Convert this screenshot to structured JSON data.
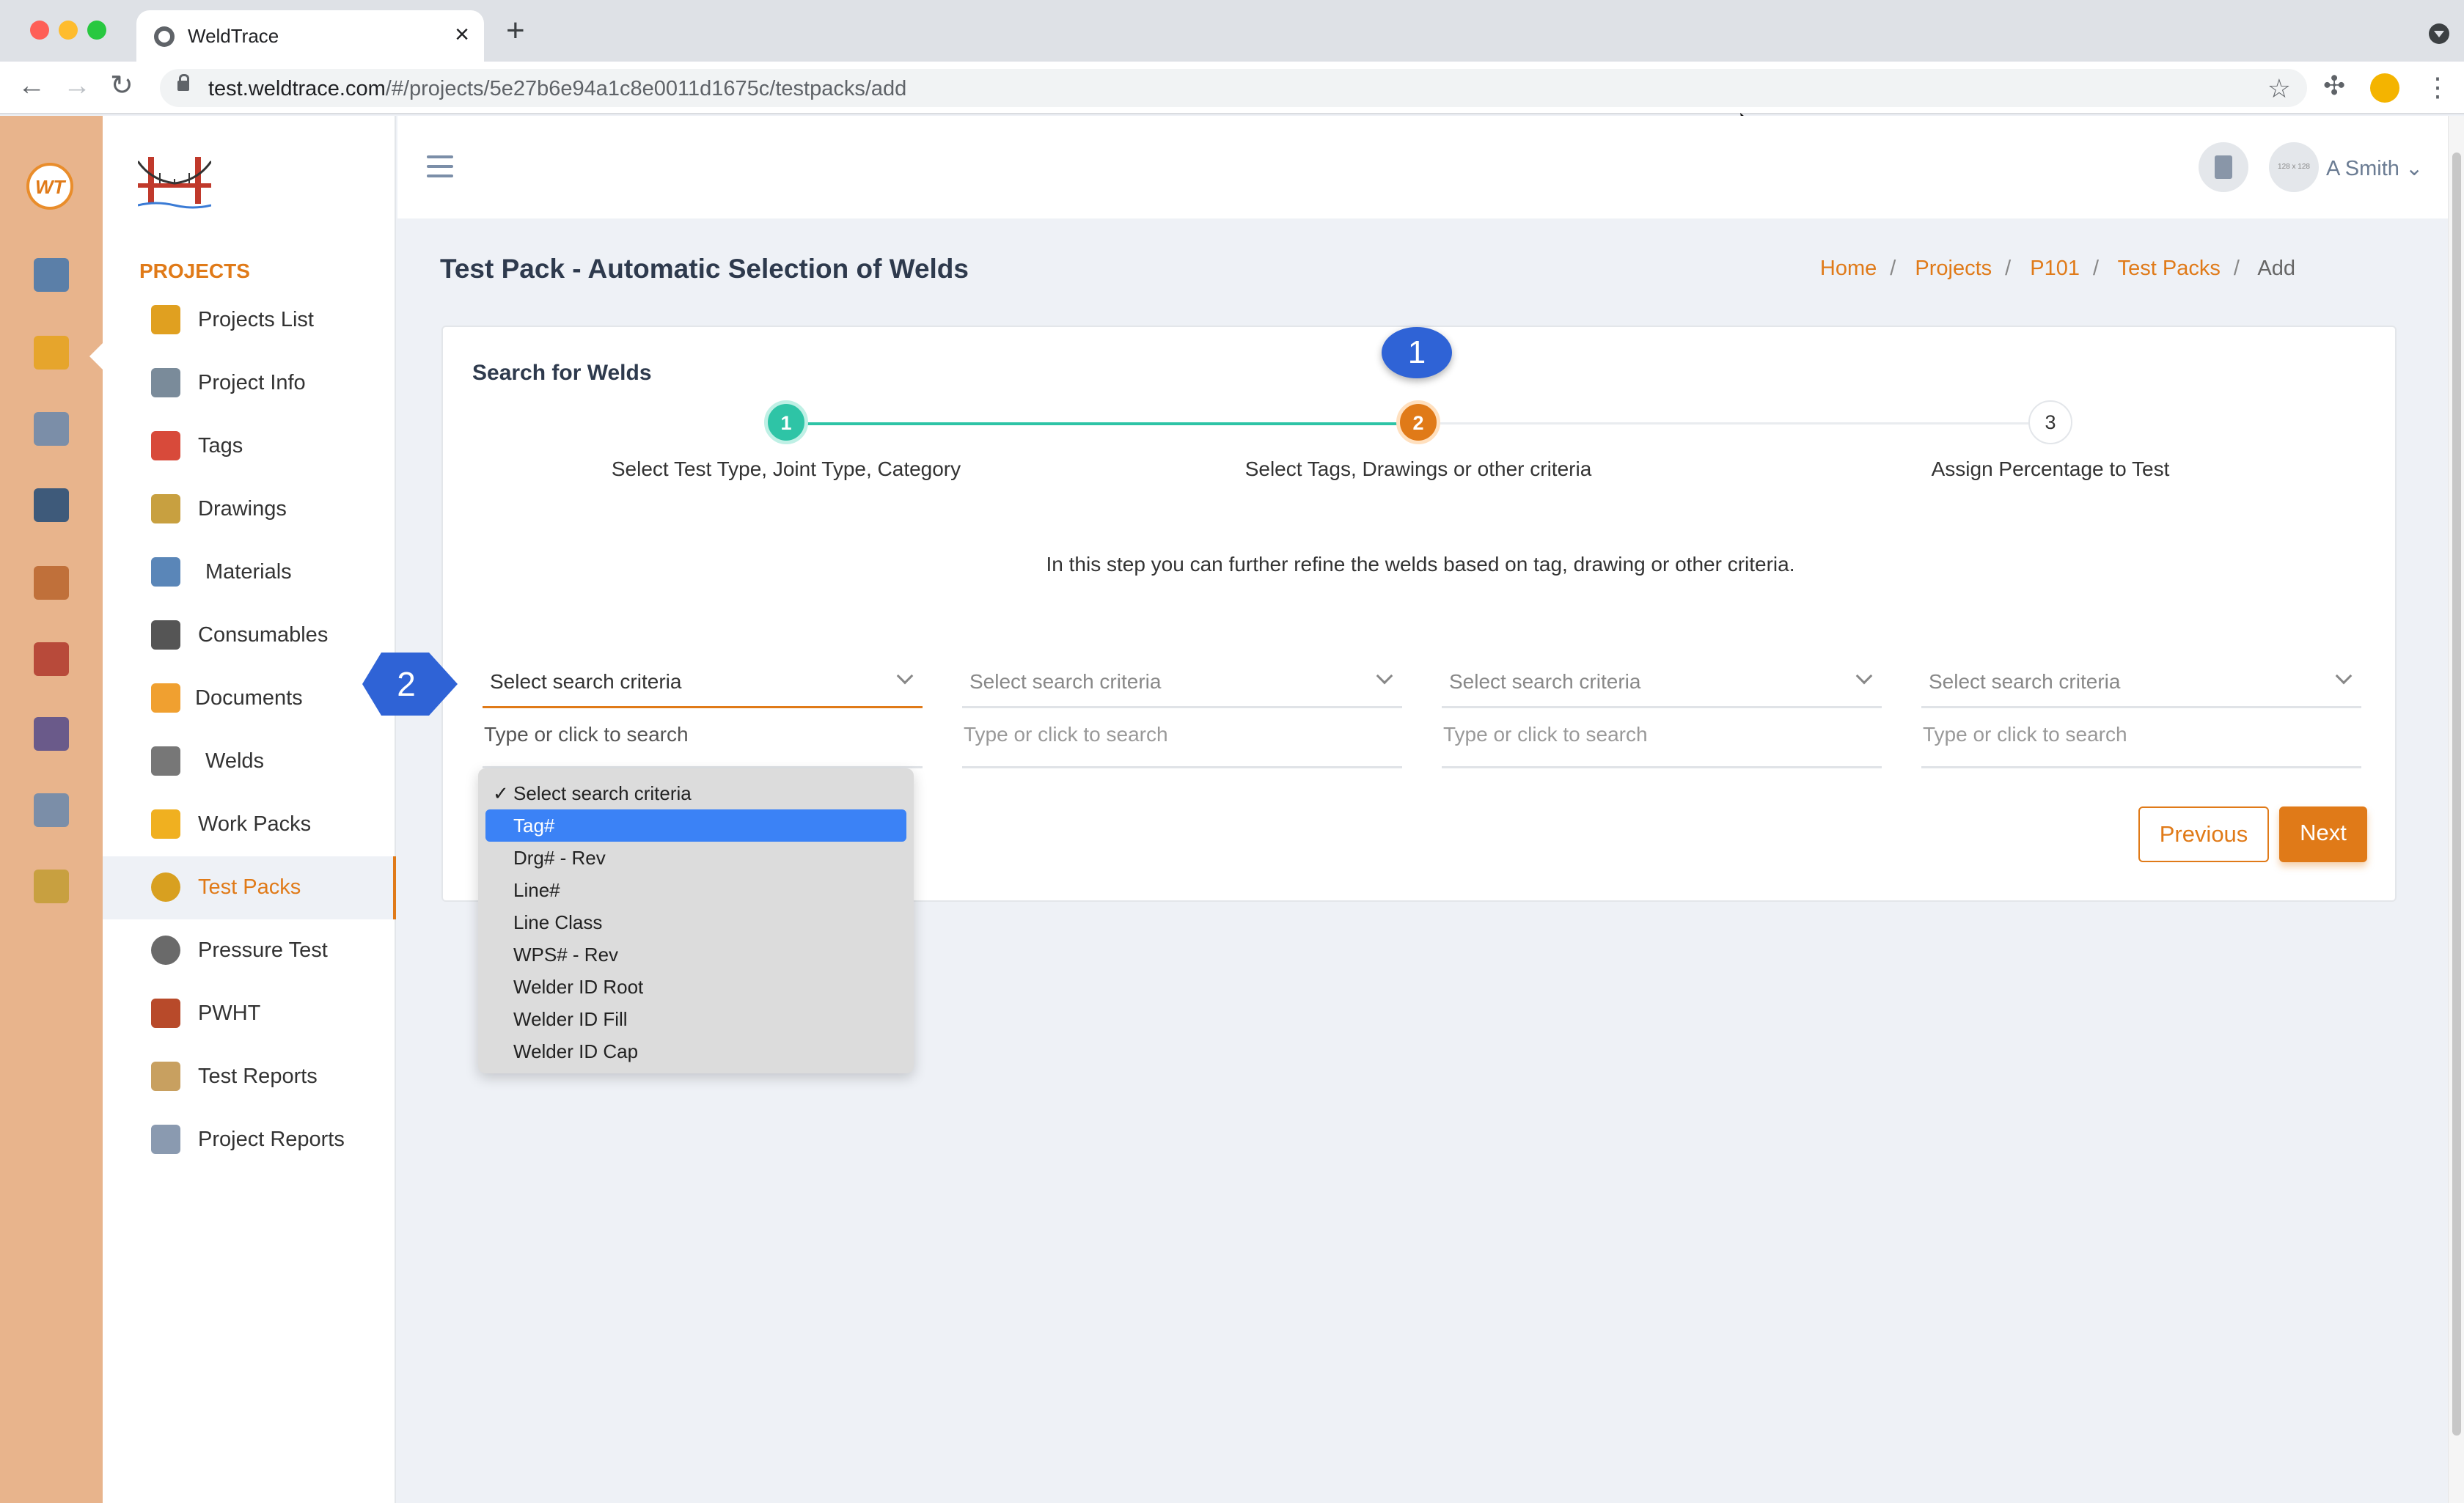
{
  "browser": {
    "tab_title": "WeldTrace",
    "url_host": "test.weldtrace.com",
    "url_path": "/#/projects/5e27b6e94a1c8e0011d1675c/testpacks/add"
  },
  "rail": {
    "logo_text": "WT",
    "icons": [
      "monitor-icon",
      "project-folder-icon",
      "clipboard-icon",
      "welder-mask-icon",
      "org-chart-icon",
      "report-icon",
      "team-icon",
      "inspection-icon",
      "certificate-icon"
    ]
  },
  "sidebar": {
    "section_title": "PROJECTS",
    "items": [
      {
        "label": "Projects List",
        "icon": "projects-list-icon",
        "color": "#e0a020"
      },
      {
        "label": "Project Info",
        "icon": "project-info-icon",
        "color": "#7a8b9a"
      },
      {
        "label": "Tags",
        "icon": "tag-icon",
        "color": "#d84a3a"
      },
      {
        "label": "Drawings",
        "icon": "drawing-icon",
        "color": "#c8a040"
      },
      {
        "label": "Materials",
        "icon": "materials-icon",
        "color": "#5a86b8"
      },
      {
        "label": "Consumables",
        "icon": "consumables-icon",
        "color": "#555555"
      },
      {
        "label": "Documents",
        "icon": "documents-icon",
        "color": "#f0a030"
      },
      {
        "label": "Welds",
        "icon": "welds-icon",
        "color": "#777777"
      },
      {
        "label": "Work Packs",
        "icon": "work-packs-icon",
        "color": "#f0b020"
      },
      {
        "label": "Test Packs",
        "icon": "test-packs-icon",
        "color": "#d8a020"
      },
      {
        "label": "Pressure Test",
        "icon": "pressure-test-icon",
        "color": "#6a6a6a"
      },
      {
        "label": "PWHT",
        "icon": "pwht-icon",
        "color": "#b84a2a"
      },
      {
        "label": "Test Reports",
        "icon": "test-reports-icon",
        "color": "#c8a060"
      },
      {
        "label": "Project Reports",
        "icon": "project-reports-icon",
        "color": "#8a9ab0"
      }
    ],
    "active_item": "Test Packs"
  },
  "header": {
    "avatar_text": "128 x 128",
    "username": "A Smith"
  },
  "page": {
    "title": "Test Pack - Automatic Selection of Welds",
    "breadcrumb": [
      "Home",
      "Projects",
      "P101",
      "Test Packs"
    ],
    "breadcrumb_current": "Add"
  },
  "card": {
    "title": "Search for Welds",
    "steps": [
      {
        "number": "1",
        "label": "Select Test Type, Joint Type, Category",
        "state": "done"
      },
      {
        "number": "2",
        "label": "Select Tags, Drawings or other criteria",
        "state": "current"
      },
      {
        "number": "3",
        "label": "Assign Percentage to Test",
        "state": "pending"
      }
    ],
    "description": "In this step you can further refine the welds based on tag, drawing or other criteria.",
    "criteria": [
      {
        "select": "Select search criteria",
        "search_placeholder": "Type or click to search"
      },
      {
        "select": "Select search criteria",
        "search_placeholder": "Type or click to search"
      },
      {
        "select": "Select search criteria",
        "search_placeholder": "Type or click to search"
      },
      {
        "select": "Select search criteria",
        "search_placeholder": "Type or click to search"
      }
    ],
    "previous_label": "Previous",
    "next_label": "Next"
  },
  "dropdown": {
    "options": [
      "Select search criteria",
      "Tag#",
      "Drg# - Rev",
      "Line#",
      "Line Class",
      "WPS# - Rev",
      "Welder ID Root",
      "Welder ID Fill",
      "Welder ID Cap"
    ],
    "selected": "Select search criteria",
    "highlighted": "Tag#"
  },
  "callouts": {
    "badge_1": "1",
    "badge_2": "2"
  },
  "colors": {
    "accent": "#e07a18",
    "step_done": "#2ec4a6",
    "callout": "#2f63d6",
    "rail": "#e8b48c"
  }
}
